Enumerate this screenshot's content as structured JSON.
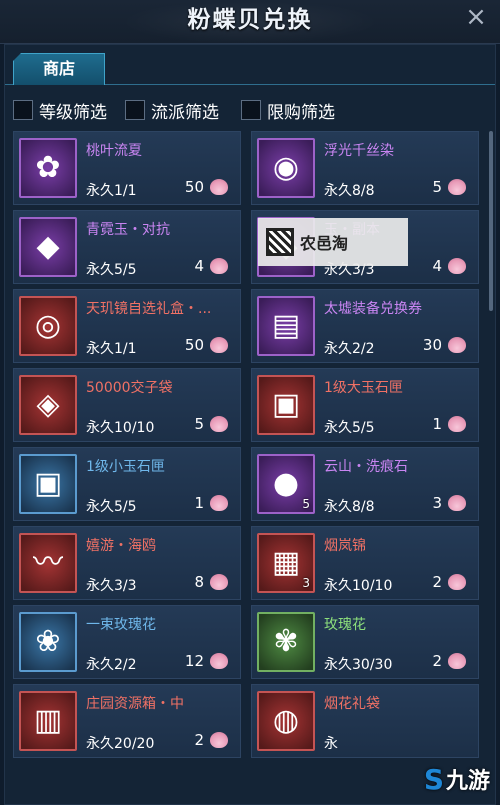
{
  "title": "粉蝶贝兑换",
  "close_icon": "×",
  "tabs": [
    {
      "label": "商店"
    }
  ],
  "filters": [
    {
      "label": "等级筛选"
    },
    {
      "label": "流派筛选"
    },
    {
      "label": "限购筛选"
    }
  ],
  "items": [
    {
      "name": "桃叶流夏",
      "rarity": "purple",
      "limit": "永久1/1",
      "price": "50",
      "icon": "flower-hairpin-icon",
      "glyph": "✿",
      "qty": ""
    },
    {
      "name": "浮光千丝染",
      "rarity": "purple",
      "limit": "永久8/8",
      "price": "5",
      "icon": "dye-bowl-icon",
      "glyph": "◉",
      "qty": ""
    },
    {
      "name": "青霓玉・对抗",
      "rarity": "purple",
      "limit": "永久5/5",
      "price": "4",
      "icon": "jade-icon",
      "glyph": "◆",
      "qty": ""
    },
    {
      "name": "玉・副本",
      "rarity": "purple",
      "limit": "永久3/3",
      "price": "4",
      "icon": "jade-icon",
      "glyph": "◆",
      "qty": ""
    },
    {
      "name": "天玑镜自选礼盒・...",
      "rarity": "red",
      "limit": "永久1/1",
      "price": "50",
      "icon": "mirror-box-icon",
      "glyph": "◎",
      "qty": ""
    },
    {
      "name": "太墟装备兑换券",
      "rarity": "purple",
      "limit": "永久2/2",
      "price": "30",
      "icon": "voucher-icon",
      "glyph": "▤",
      "qty": ""
    },
    {
      "name": "50000交子袋",
      "rarity": "red",
      "limit": "永久10/10",
      "price": "5",
      "icon": "money-pouch-icon",
      "glyph": "◈",
      "qty": ""
    },
    {
      "name": "1级大玉石匣",
      "rarity": "red",
      "limit": "永久5/5",
      "price": "1",
      "icon": "jade-chest-icon",
      "glyph": "▣",
      "qty": ""
    },
    {
      "name": "1级小玉石匣",
      "rarity": "blue",
      "limit": "永久5/5",
      "price": "1",
      "icon": "small-chest-icon",
      "glyph": "▣",
      "qty": ""
    },
    {
      "name": "云山・洗痕石",
      "rarity": "purple",
      "limit": "永久8/8",
      "price": "3",
      "icon": "stone-icon",
      "glyph": "●",
      "qty": "5"
    },
    {
      "name": "嬉游・海鸥",
      "rarity": "red",
      "limit": "永久3/3",
      "price": "8",
      "icon": "seagull-icon",
      "glyph": "〰",
      "qty": ""
    },
    {
      "name": "烟岚锦",
      "rarity": "red",
      "limit": "永久10/10",
      "price": "2",
      "icon": "brocade-icon",
      "glyph": "▦",
      "qty": "3"
    },
    {
      "name": "一束玫瑰花",
      "rarity": "blue",
      "limit": "永久2/2",
      "price": "12",
      "icon": "rose-bouquet-icon",
      "glyph": "❀",
      "qty": ""
    },
    {
      "name": "玫瑰花",
      "rarity": "green",
      "limit": "永久30/30",
      "price": "2",
      "icon": "rose-icon",
      "glyph": "✾",
      "qty": ""
    },
    {
      "name": "庄园资源箱・中",
      "rarity": "red",
      "limit": "永久20/20",
      "price": "2",
      "icon": "resource-box-icon",
      "glyph": "▥",
      "qty": ""
    },
    {
      "name": "烟花礼袋",
      "rarity": "red",
      "limit": "永",
      "price": "",
      "icon": "firework-bag-icon",
      "glyph": "◍",
      "qty": ""
    }
  ],
  "watermark": {
    "text": "农邑淘"
  },
  "logo": {
    "text": "九游",
    "mark": "S"
  }
}
